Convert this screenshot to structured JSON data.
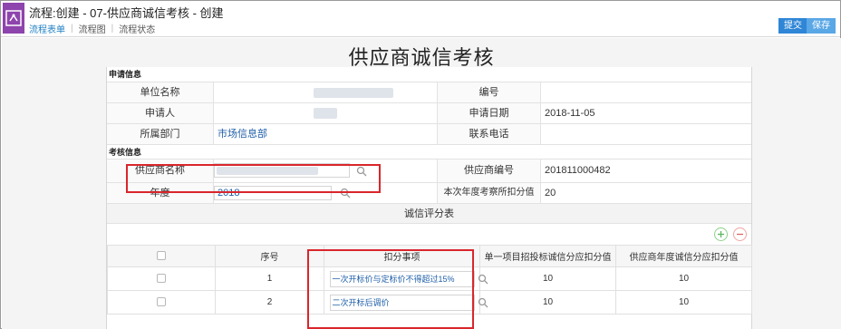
{
  "app": {
    "title": "流程:创建 - 07-供应商诚信考核 - 创建",
    "tabs": [
      {
        "label": "流程表单",
        "active": true
      },
      {
        "label": "流程图",
        "active": false
      },
      {
        "label": "流程状态",
        "active": false
      }
    ],
    "buttons": {
      "submit": "提交",
      "save": "保存"
    }
  },
  "form": {
    "title": "供应商诚信考核",
    "apply_section": {
      "header": "申请信息",
      "unit_label": "单位名称",
      "number_label": "编号",
      "number_value": "",
      "applicant_label": "申请人",
      "apply_date_label": "申请日期",
      "apply_date_value": "2018-11-05",
      "department_label": "所属部门",
      "department_value": "市场信息部",
      "phone_label": "联系电话",
      "phone_value": ""
    },
    "assess_section": {
      "header": "考核信息",
      "supplier_name_label": "供应商名称",
      "supplier_code_label": "供应商编号",
      "supplier_code_value": "201811000482",
      "year_label": "年度",
      "year_value": "2018",
      "deduct_label": "本次年度考察所扣分值",
      "deduct_value": "20"
    },
    "score_table": {
      "title": "诚信评分表",
      "columns": [
        "序号",
        "扣分事项",
        "单一项目招投标诚信分应扣分值",
        "供应商年度诚信分应扣分值"
      ],
      "rows": [
        {
          "index": "1",
          "item": "一次开标价与定标价不得超过15%",
          "single": "10",
          "annual": "10"
        },
        {
          "index": "2",
          "item": "二次开标后调价",
          "single": "10",
          "annual": "10"
        }
      ]
    }
  },
  "colors": {
    "accent": "#2f86d6",
    "link": "#1f5fa8",
    "highlight": "#d9262c",
    "logo": "#8e44ad",
    "add": "#5cb85c",
    "delete": "#e06666"
  }
}
